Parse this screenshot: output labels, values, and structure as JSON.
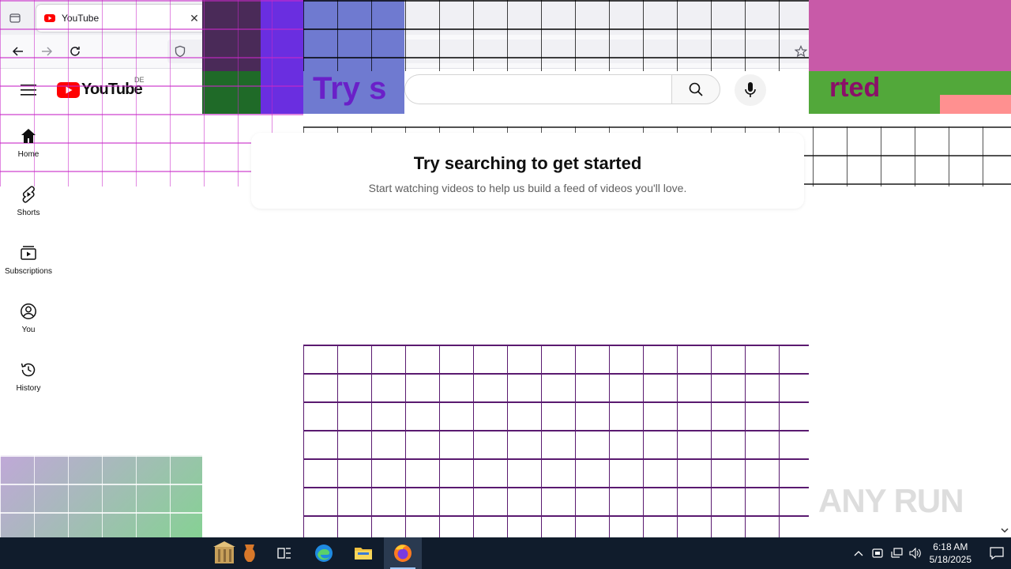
{
  "browser": {
    "tab_title": "YouTube",
    "tab_close": "✕"
  },
  "youtube": {
    "logo_word": "YouTube",
    "region": "DE",
    "search_placeholder": "",
    "guide": [
      {
        "label": "Home",
        "icon": "home-icon"
      },
      {
        "label": "Shorts",
        "icon": "shorts-icon"
      },
      {
        "label": "Subscriptions",
        "icon": "subscriptions-icon"
      },
      {
        "label": "You",
        "icon": "account-icon"
      },
      {
        "label": "History",
        "icon": "history-icon"
      }
    ],
    "prompt": {
      "title": "Try searching to get started",
      "subtitle": "Start watching videos to help us build a feed of videos you'll love."
    },
    "artifact_text": "Try s",
    "artifact_text_right": "rted"
  },
  "overlay": {
    "watermark": "ANY RUN"
  },
  "taskbar": {
    "time": "6:18 AM",
    "date": "5/18/2025"
  },
  "colors": {
    "youtube_red": "#ff0000",
    "taskbar": "#101c2c"
  }
}
